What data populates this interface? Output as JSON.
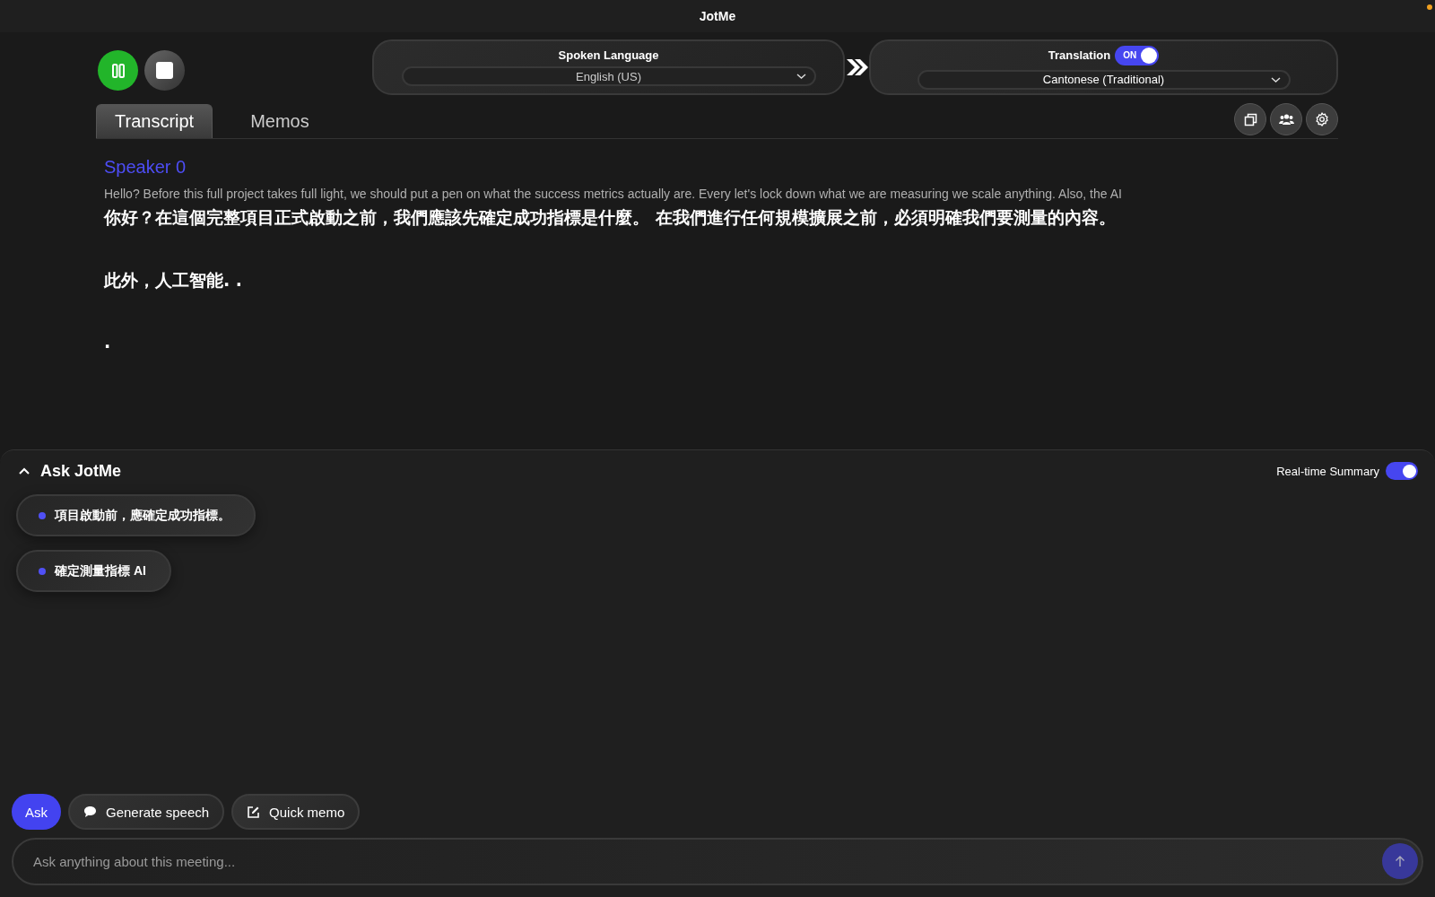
{
  "window": {
    "title": "JotMe"
  },
  "controls": {
    "pause_button": {
      "active": true
    },
    "spoken_language": {
      "label": "Spoken Language",
      "value": "English (US)"
    },
    "translation": {
      "label": "Translation",
      "on": true,
      "toggle_text": "ON",
      "value": "Cantonese (Traditional)"
    }
  },
  "tabs": [
    {
      "label": "Transcript",
      "selected": true
    },
    {
      "label": "Memos",
      "selected": false
    }
  ],
  "transcript": {
    "speaker": "Speaker 0",
    "original": "Hello? Before this full project takes full light, we should put a pen on what the success metrics actually are. Every let's lock down what we are measuring we scale anything. Also, the AI",
    "translation": [
      "你好？在這個完整項目正式啟動之前，我們應該先確定成功指標是什麼。 在我們進行任何規模擴展之前，必須明確我們要測量的內容。",
      "此外，人工智能. .",
      "."
    ]
  },
  "ask_panel": {
    "title": "Ask JotMe",
    "expanded": true,
    "real_time_summary": {
      "label": "Real-time Summary",
      "on": true
    },
    "summary_items": [
      "項目啟動前，應確定成功指標。",
      "確定測量指標 AI"
    ],
    "actions": [
      {
        "label": "Ask",
        "kind": "plain",
        "selected": true
      },
      {
        "label": "Generate speech",
        "kind": "speech",
        "selected": false
      },
      {
        "label": "Quick memo",
        "kind": "memo",
        "selected": false
      }
    ],
    "input": {
      "placeholder": "Ask anything about this meeting..."
    }
  }
}
